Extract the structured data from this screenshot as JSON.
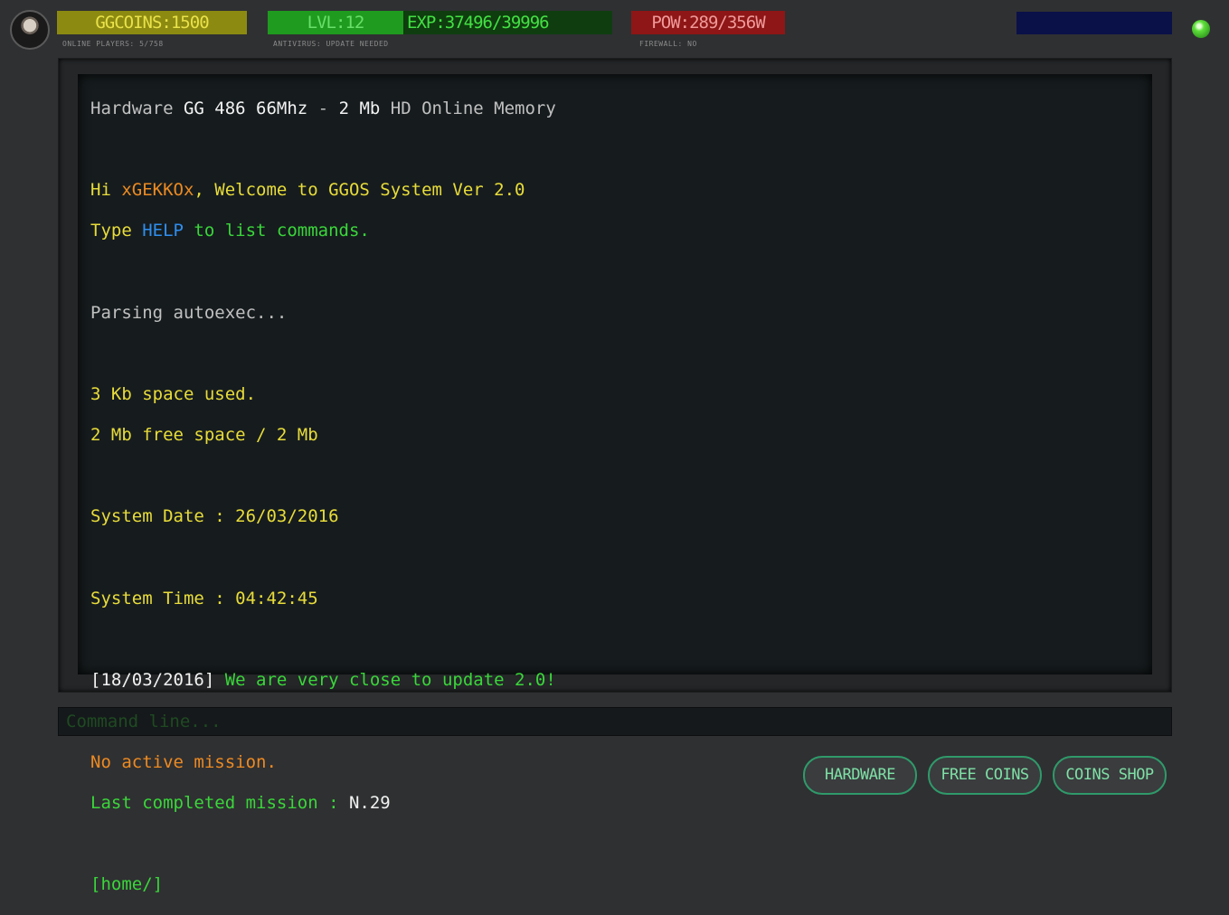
{
  "header": {
    "coins": "GGCOINS:1500",
    "online_players": "ONLINE PLAYERS: 5/758",
    "level": "LVL:12",
    "exp": "EXP:37496/39996",
    "update_notice": "ANTIVIRUS: UPDATE NEEDED",
    "power": "POW:289/356W",
    "firewall": "FIREWALL: NO"
  },
  "terminal": {
    "hardware": {
      "prefix": "Hardware ",
      "cpu": "GG 486 66Mhz",
      "sep": " - ",
      "hd": "2 Mb",
      "suffix": " HD Online Memory"
    },
    "welcome": {
      "hi": "Hi ",
      "user": "xGEKKOx",
      "rest": ", Welcome to GGOS System Ver 2.0"
    },
    "help": {
      "type": "Type ",
      "cmd": "HELP",
      "rest": " to list commands."
    },
    "parsing": "Parsing autoexec...",
    "space_used": "3 Kb space used.",
    "space_free": "2 Mb free space / 2 Mb",
    "date": "System Date : 26/03/2016",
    "time": "System Time : 04:42:45",
    "news": {
      "date": "[18/03/2016]",
      "text": " We are very close to update 2.0!"
    },
    "mission_status": "No active mission.",
    "last_mission": {
      "label": "Last completed mission : ",
      "value": "N.29"
    },
    "prompt": "[home/]"
  },
  "command_line": {
    "placeholder": "Command line..."
  },
  "buttons": {
    "hardware": "HARDWARE",
    "free_coins": "FREE COINS",
    "coins_shop": "COINS SHOP"
  },
  "colors": {
    "accent_green": "#3ad63a",
    "terminal_bg": "#161c1e",
    "button_border": "#2f9a6a"
  }
}
